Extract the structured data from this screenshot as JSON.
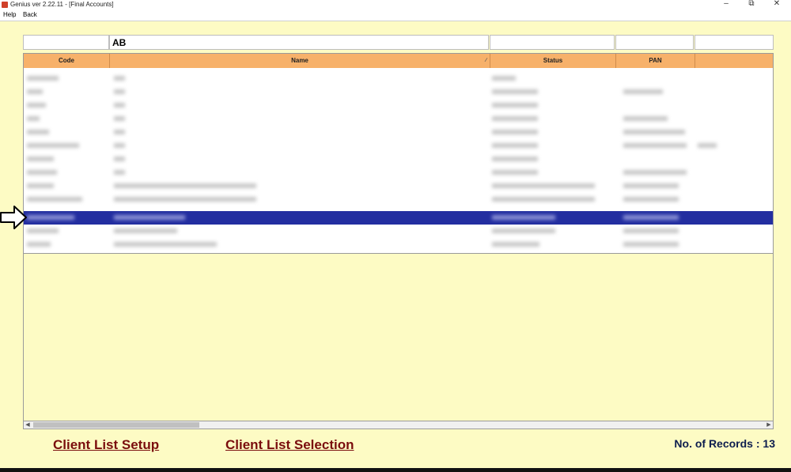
{
  "window": {
    "title": "Genius ver 2.22.11 - [Final Accounts]",
    "minimize": "–",
    "maximize": "⧉",
    "close": "✕"
  },
  "menu": {
    "items": [
      "Help",
      "Back"
    ]
  },
  "filters": {
    "code": "",
    "name": "AB",
    "status": "",
    "pan": "",
    "extra": ""
  },
  "grid": {
    "columns": [
      "Code",
      "Name",
      "Status",
      "PAN",
      ""
    ],
    "sort_indicator": "∕",
    "selected_row_index": 11,
    "row_count_visible": 13
  },
  "footer": {
    "client_list_setup": "Client List Setup",
    "client_list_selection": "Client List Selection",
    "records_label": "No. of Records : 13"
  },
  "icons": {
    "app": "app-icon",
    "row_pointer": "right-arrow-icon"
  }
}
